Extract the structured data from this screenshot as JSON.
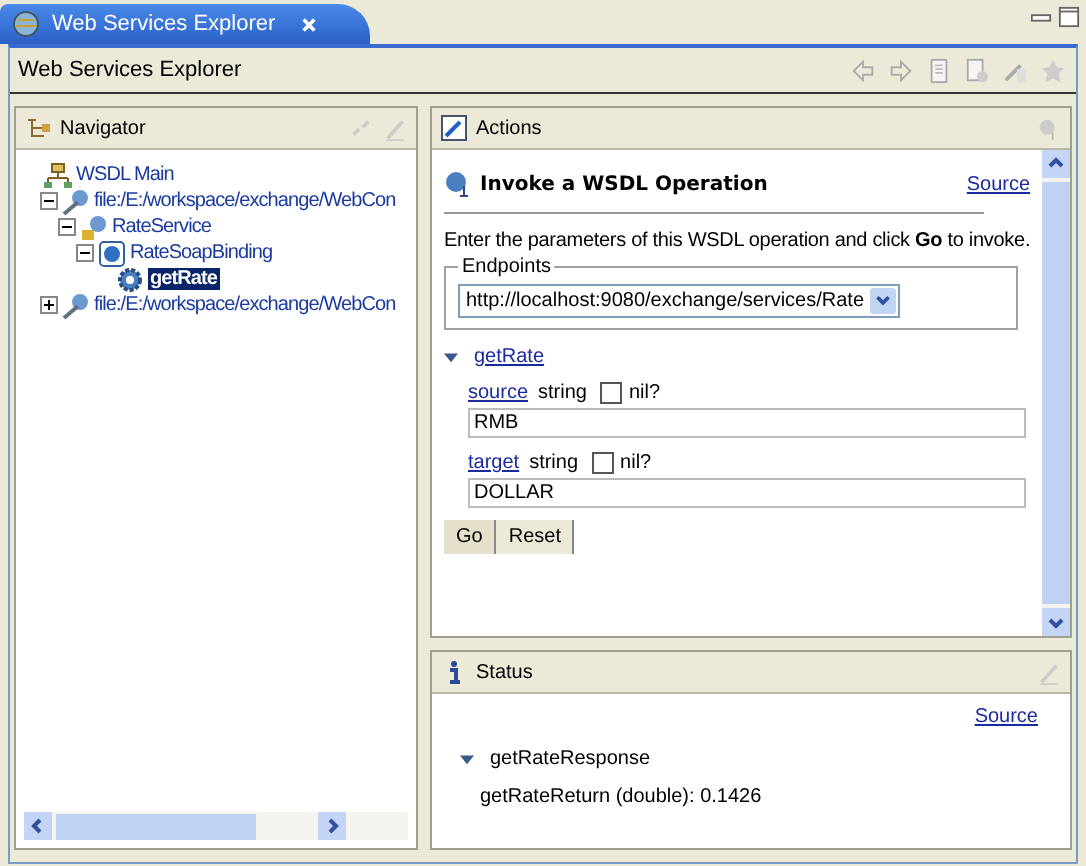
{
  "tab": {
    "title": "Web Services Explorer"
  },
  "toolbar": {
    "title": "Web Services Explorer"
  },
  "navigator": {
    "title": "Navigator",
    "tree": [
      {
        "label": "WSDL Main",
        "kind": "main",
        "children": [
          {
            "label": "file:/E:/workspace/exchange/WebCon",
            "kind": "file",
            "expanded": true,
            "children": [
              {
                "label": "RateService",
                "kind": "service",
                "expanded": true,
                "children": [
                  {
                    "label": "RateSoapBinding",
                    "kind": "binding",
                    "expanded": true,
                    "children": [
                      {
                        "label": "getRate",
                        "kind": "operation",
                        "selected": true
                      }
                    ]
                  }
                ]
              }
            ]
          },
          {
            "label": "file:/E:/workspace/exchange/WebCon",
            "kind": "file",
            "expanded": false
          }
        ]
      }
    ]
  },
  "actions": {
    "title": "Actions",
    "heading": "Invoke a WSDL Operation",
    "source_link": "Source",
    "intro": "Enter the parameters of this WSDL operation and click **Go** to invoke.",
    "endpoints": {
      "legend": "Endpoints",
      "value": "http://localhost:9080/exchange/services/Rate"
    },
    "operation": {
      "label": "getRate",
      "expanded": true
    },
    "params": [
      {
        "name": "source",
        "type": "string",
        "nil_label": "nil?",
        "nil": false,
        "value": "RMB"
      },
      {
        "name": "target",
        "type": "string",
        "nil_label": "nil?",
        "nil": false,
        "value": "DOLLAR"
      }
    ],
    "buttons": [
      "Go",
      "Reset"
    ]
  },
  "status": {
    "title": "Status",
    "source_link": "Source",
    "response": {
      "label": "getRateResponse",
      "expanded": true
    },
    "result": "getRateReturn (double):  0.1426"
  }
}
